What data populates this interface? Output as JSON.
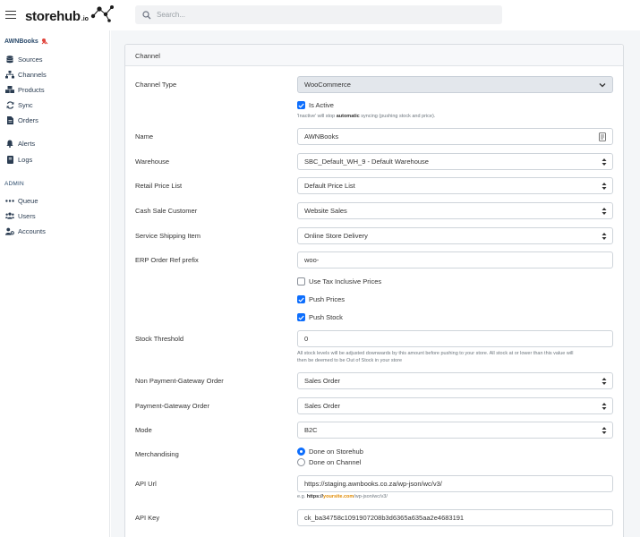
{
  "header": {
    "logo_text": "storehub",
    "logo_suffix": ".io",
    "search_placeholder": "Search..."
  },
  "sidebar": {
    "org_name": "AWNBooks",
    "items": [
      {
        "label": "Sources",
        "icon": "database-icon"
      },
      {
        "label": "Channels",
        "icon": "sitemap-icon"
      },
      {
        "label": "Products",
        "icon": "boxes-icon"
      },
      {
        "label": "Sync",
        "icon": "sync-icon"
      },
      {
        "label": "Orders",
        "icon": "file-icon"
      },
      {
        "label": "Alerts",
        "icon": "bell-icon"
      },
      {
        "label": "Logs",
        "icon": "book-icon"
      }
    ],
    "admin_label": "ADMIN",
    "admin_items": [
      {
        "label": "Queue",
        "icon": "ellipsis-icon"
      },
      {
        "label": "Users",
        "icon": "users-icon"
      },
      {
        "label": "Accounts",
        "icon": "user-cog-icon"
      }
    ]
  },
  "form": {
    "card_title": "Channel",
    "channel_type_label": "Channel Type",
    "channel_type_value": "WooCommerce",
    "is_active_label": "Is Active",
    "is_active_checked": true,
    "is_active_help_pre": "'Inactive' will stop ",
    "is_active_help_bold": "automatic",
    "is_active_help_post": " syncing (pushing stock and price).",
    "name_label": "Name",
    "name_value": "AWNBooks",
    "warehouse_label": "Warehouse",
    "warehouse_value": "SBC_Default_WH_9 - Default Warehouse",
    "retail_price_label": "Retail Price List",
    "retail_price_value": "Default Price List",
    "cash_sale_label": "Cash Sale Customer",
    "cash_sale_value": "Website Sales",
    "shipping_label": "Service Shipping Item",
    "shipping_value": "Online Store Delivery",
    "erp_prefix_label": "ERP Order Ref prefix",
    "erp_prefix_value": "woo-",
    "tax_inclusive_label": "Use Tax Inclusive Prices",
    "tax_inclusive_checked": false,
    "push_prices_label": "Push Prices",
    "push_prices_checked": true,
    "push_stock_label": "Push Stock",
    "push_stock_checked": true,
    "stock_threshold_label": "Stock Threshold",
    "stock_threshold_value": "0",
    "stock_threshold_help_1": "All stock levels will be adjusted downwards by this amount before pushing to your store. All stock at or lower than this value will",
    "stock_threshold_help_2": "then be deemed to be Out of Stock in your store",
    "non_pg_order_label": "Non Payment-Gateway Order",
    "non_pg_order_value": "Sales Order",
    "pg_order_label": "Payment-Gateway Order",
    "pg_order_value": "Sales Order",
    "mode_label": "Mode",
    "mode_value": "B2C",
    "merch_label": "Merchandising",
    "merch_option_1": "Done on Storehub",
    "merch_option_2": "Done on Channel",
    "merch_selected": "Done on Storehub",
    "api_url_label": "API Url",
    "api_url_value": "https://staging.awnbooks.co.za/wp-json/wc/v3/",
    "api_url_help_pre": "e.g. ",
    "api_url_help_a": "https://",
    "api_url_help_b": "yoursite.com",
    "api_url_help_c": "/wp-json/wc/v3/",
    "api_key_label": "API Key",
    "api_key_value": "ck_ba34758c1091907208b3d6365a635aa2e4683191"
  },
  "colors": {
    "accent": "#0d6efd",
    "nav_text": "#2b3d52",
    "help_highlight": "#e08a00"
  }
}
